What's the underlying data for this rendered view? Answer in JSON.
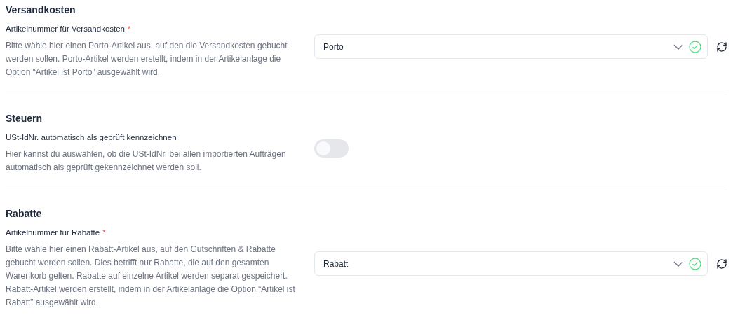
{
  "sections": [
    {
      "title": "Versandkosten",
      "kind": "select",
      "label": "Artikelnummer für Versandkosten",
      "required_mark": "*",
      "description": "Bitte wähle hier einen Porto-Artikel aus, auf den die Versandkosten gebucht werden sollen. Porto-Artikel werden erstellt, indem in der Artikelanlage die Option “Artikel ist Porto” ausgewählt wird.",
      "value": "Porto",
      "valid": true
    },
    {
      "title": "Steuern",
      "kind": "toggle",
      "label": "USt-IdNr. automatisch als geprüft kennzeichnen",
      "description": "Hier kannst du auswählen, ob die USt-IdNr. bei allen importierten Aufträgen automatisch als geprüft gekennzeichnet werden soll.",
      "on": false
    },
    {
      "title": "Rabatte",
      "kind": "select",
      "label": "Artikelnummer für Rabatte",
      "required_mark": "*",
      "description": "Bitte wähle hier einen Rabatt-Artikel aus, auf den Gutschriften & Rabatte gebucht werden sollen. Dies betrifft nur Rabatte, die auf den gesamten Warenkorb gelten. Rabatte auf einzelne Artikel werden separat gespeichert. Rabatt-Artikel werden erstellt, indem in der Artikelanlage die Option “Artikel ist Rabatt” ausgewählt wird.",
      "value": "Rabatt",
      "valid": true
    }
  ]
}
